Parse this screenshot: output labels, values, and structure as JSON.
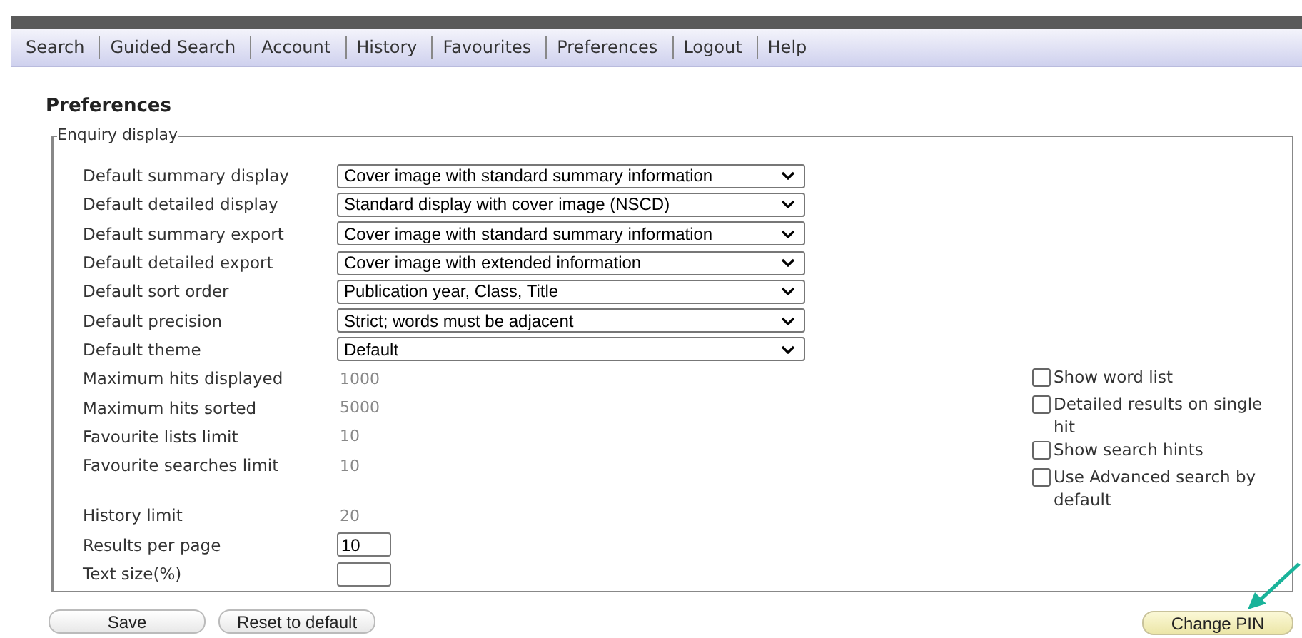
{
  "nav": [
    "Search",
    "Guided Search",
    "Account",
    "History",
    "Favourites",
    "Preferences",
    "Logout",
    "Help"
  ],
  "page_title": "Preferences",
  "fieldset": {
    "legend": "Enquiry display",
    "settings": [
      {
        "kind": "select",
        "label": "Default summary display",
        "value": "Cover image with standard summary information"
      },
      {
        "kind": "select",
        "label": "Default detailed display",
        "value": "Standard display with cover image (NSCD)"
      },
      {
        "kind": "select",
        "label": "Default summary export",
        "value": "Cover image with standard summary information"
      },
      {
        "kind": "select",
        "label": "Default detailed export",
        "value": "Cover image with extended information"
      },
      {
        "kind": "select",
        "label": "Default sort order",
        "value": "Publication year, Class, Title"
      },
      {
        "kind": "select",
        "label": "Default precision",
        "value": "Strict; words must be adjacent"
      },
      {
        "kind": "select",
        "label": "Default theme",
        "value": "Default"
      },
      {
        "kind": "readonly",
        "label": "Maximum hits displayed",
        "value": "1000"
      },
      {
        "kind": "readonly",
        "label": "Maximum hits sorted",
        "value": "5000"
      },
      {
        "kind": "readonly",
        "label": "Favourite lists limit",
        "value": "10"
      },
      {
        "kind": "readonly",
        "label": "Favourite searches limit",
        "value": "10"
      }
    ],
    "session_settings": [
      {
        "kind": "readonly",
        "label": "History limit",
        "value": "20"
      },
      {
        "kind": "input",
        "label": "Results per page",
        "value": "10"
      },
      {
        "kind": "input",
        "label": "Text size(%)"
      }
    ],
    "options": [
      {
        "label": "Show word list",
        "checked": false
      },
      {
        "label": "Detailed results on single hit",
        "checked": false
      },
      {
        "label": "Show search hints",
        "checked": false
      },
      {
        "label": "Use Advanced search by default",
        "checked": false
      }
    ]
  },
  "buttons": [
    "Save",
    "Reset to default"
  ],
  "change_pin_button": "Change PIN"
}
